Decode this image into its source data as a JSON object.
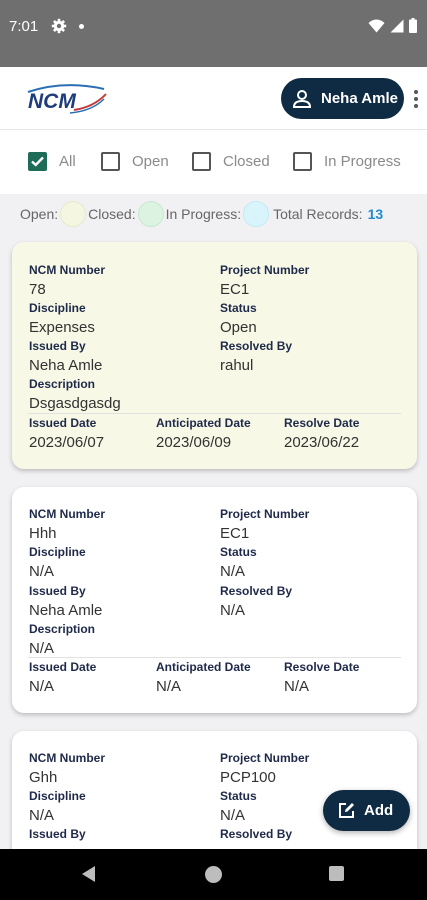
{
  "status_bar": {
    "time": "7:01"
  },
  "header": {
    "logo_text": "NCM",
    "user_name": "Neha Amle"
  },
  "filters": [
    {
      "label": "All",
      "checked": true
    },
    {
      "label": "Open",
      "checked": false
    },
    {
      "label": "Closed",
      "checked": false
    },
    {
      "label": "In Progress",
      "checked": false
    }
  ],
  "legend": {
    "open_label": "Open:",
    "closed_label": "Closed:",
    "in_progress_label": "In Progress:",
    "total_label": "Total Records:",
    "total_count": "13",
    "colors": {
      "open": "#f4f6e2",
      "closed": "#ddf3e2",
      "in_progress": "#d9f5fb"
    }
  },
  "labels": {
    "ncm_number": "NCM Number",
    "project_number": "Project Number",
    "discipline": "Discipline",
    "status": "Status",
    "issued_by": "Issued By",
    "resolved_by": "Resolved By",
    "description": "Description",
    "issued_date": "Issued Date",
    "anticipated_date": "Anticipated Date",
    "resolve_date": "Resolve Date"
  },
  "records": [
    {
      "ncm_number": "78",
      "project_number": "EC1",
      "discipline": "Expenses",
      "status": "Open",
      "issued_by": "Neha Amle",
      "resolved_by": "rahul",
      "description": "Dsgasdgasdg",
      "issued_date": "2023/06/07",
      "anticipated_date": "2023/06/09",
      "resolve_date": "2023/06/22",
      "bg": "#f7f8e6"
    },
    {
      "ncm_number": "Hhh",
      "project_number": "EC1",
      "discipline": "N/A",
      "status": "N/A",
      "issued_by": "Neha Amle",
      "resolved_by": "N/A",
      "description": "N/A",
      "issued_date": "N/A",
      "anticipated_date": "N/A",
      "resolve_date": "N/A",
      "bg": "#ffffff"
    },
    {
      "ncm_number": "Ghh",
      "project_number": "PCP100",
      "discipline": "N/A",
      "status": "N/A",
      "issued_by": "",
      "resolved_by": "",
      "description": "",
      "issued_date": "",
      "anticipated_date": "",
      "resolve_date": "",
      "bg": "#ffffff"
    }
  ],
  "fab": {
    "label": "Add"
  },
  "colors": {
    "primary": "#0f2a43",
    "check_green": "#1e6b57",
    "count_blue": "#1f8bd0"
  }
}
